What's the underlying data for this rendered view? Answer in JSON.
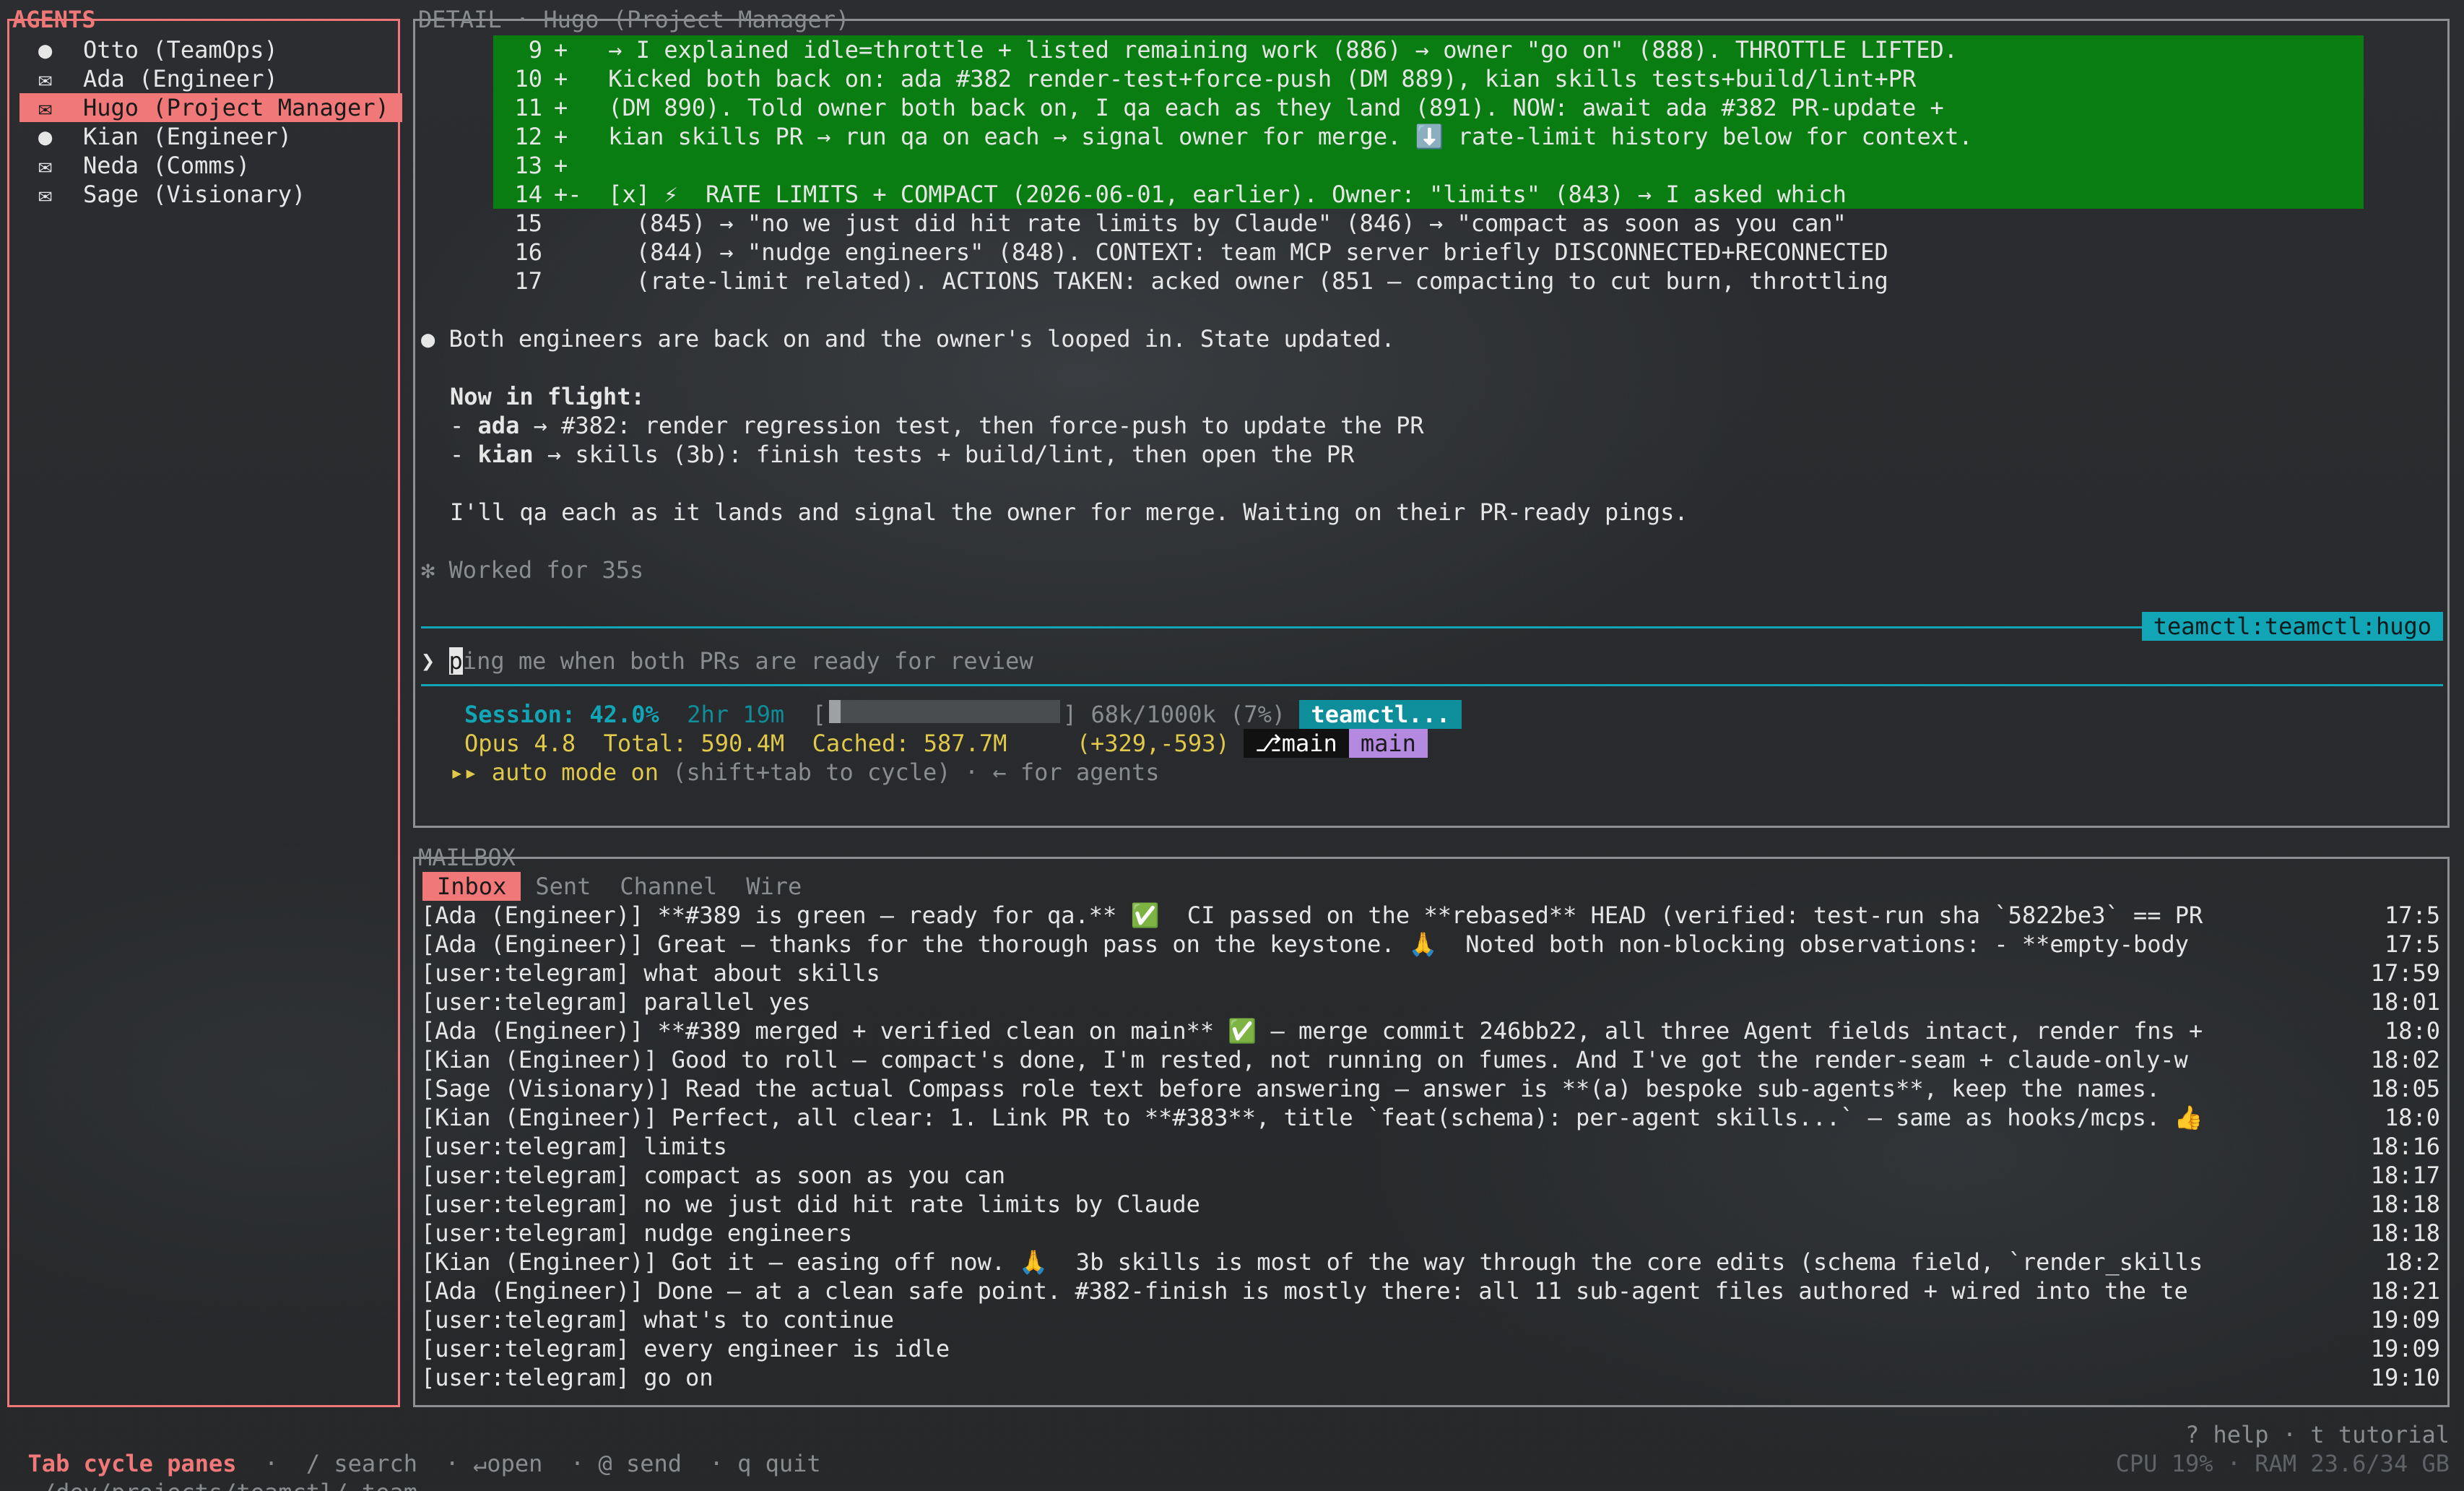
{
  "agents": {
    "title": "AGENTS",
    "items": [
      {
        "mark": "●",
        "name": "Otto (TeamOps)"
      },
      {
        "mark": "✉",
        "name": "Ada (Engineer)"
      },
      {
        "mark": "✉",
        "name": "Hugo (Project Manager)",
        "selected": true
      },
      {
        "mark": "●",
        "name": "Kian (Engineer)"
      },
      {
        "mark": "✉",
        "name": "Neda (Comms)"
      },
      {
        "mark": "✉",
        "name": "Sage (Visionary)"
      }
    ]
  },
  "detail": {
    "title": "DETAIL · Hugo (Project Manager)",
    "diff": [
      {
        "num": "9",
        "sign": "+",
        "text": " → I explained idle=throttle + listed remaining work (886) → owner \"go on\" (888). THROTTLE LIFTED.",
        "added": true
      },
      {
        "num": "10",
        "sign": "+",
        "text": " Kicked both back on: ada #382 render-test+force-push (DM 889), kian skills tests+build/lint+PR",
        "added": true
      },
      {
        "num": "11",
        "sign": "+",
        "text": " (DM 890). Told owner both back on, I qa each as they land (891). NOW: await ada #382 PR-update +",
        "added": true
      },
      {
        "num": "12",
        "sign": "+",
        "text": " kian skills PR → run qa on each → signal owner for merge. ⬇️ rate-limit history below for context.",
        "added": true
      },
      {
        "num": "13",
        "sign": "+",
        "text": "",
        "added": true
      },
      {
        "num": "14",
        "sign": "+-",
        "text": " [x] ⚡  RATE LIMITS + COMPACT (2026-06-01, earlier). Owner: \"limits\" (843) → I asked which",
        "added": true
      },
      {
        "num": "15",
        "sign": "",
        "text": "   (845) → \"no we just did hit rate limits by Claude\" (846) → \"compact as soon as you can\"",
        "added": false
      },
      {
        "num": "16",
        "sign": "",
        "text": "   (844) → \"nudge engineers\" (848). CONTEXT: team MCP server briefly DISCONNECTED+RECONNECTED",
        "added": false
      },
      {
        "num": "17",
        "sign": "",
        "text": "   (rate-limit related). ACTIONS TAKEN: acked owner (851 — compacting to cut burn, throttling",
        "added": false
      }
    ],
    "summary": "● Both engineers are back on and the owner's looped in. State updated.",
    "inflight_title": "Now in flight:",
    "inflight": [
      {
        "who": "ada",
        "text": " → #382: render regression test, then force-push to update the PR"
      },
      {
        "who": "kian",
        "text": " → skills (3b): finish tests + build/lint, then open the PR"
      }
    ],
    "closing": "I'll qa each as it lands and signal the owner for merge. Waiting on their PR-ready pings.",
    "worked": "✻ Worked for 35s",
    "session_tag": "teamctl:teamctl:hugo",
    "prompt_symbol": "❯",
    "prompt_first": "p",
    "prompt_rest": "ing me when both PRs are ready for review",
    "status": {
      "session_label": "Session:",
      "session_pct": "42.0%",
      "elapsed": "2hr 19m",
      "context_usage_fraction": 0.07,
      "tokens": "68k/1000k (7%)",
      "tag1": "teamctl...",
      "model": "Opus 4.8",
      "total": "Total: 590.4M",
      "cached": "Cached: 587.7M",
      "diffstat": "(+329,-593)",
      "branch_icon": "⎇",
      "branch1": "main",
      "branch2": "main",
      "auto_prefix": "▸▸ auto mode on",
      "auto_hint": " (shift+tab to cycle) · ← for agents"
    }
  },
  "mailbox": {
    "title": "MAILBOX",
    "tabs": [
      "Inbox",
      "Sent",
      "Channel",
      "Wire"
    ],
    "messages": [
      {
        "text": "[Ada (Engineer)] **#389 is green — ready for qa.** ✅  CI passed on the **rebased** HEAD (verified: test-run sha `5822be3` == PR",
        "time": "17:5"
      },
      {
        "text": "[Ada (Engineer)] Great — thanks for the thorough pass on the keystone. 🙏  Noted both non-blocking observations: - **empty-body",
        "time": "17:5"
      },
      {
        "text": "[user:telegram] what about skills",
        "time": "17:59"
      },
      {
        "text": "[user:telegram] parallel yes",
        "time": "18:01"
      },
      {
        "text": "[Ada (Engineer)] **#389 merged + verified clean on main** ✅ — merge commit 246bb22, all three Agent fields intact, render fns +",
        "time": "18:0"
      },
      {
        "text": "[Kian (Engineer)] Good to roll — compact's done, I'm rested, not running on fumes. And I've got the render-seam + claude-only-w",
        "time": "18:02"
      },
      {
        "text": "[Sage (Visionary)] Read the actual Compass role text before answering — answer is **(a) bespoke sub-agents**, keep the names.",
        "time": "18:05"
      },
      {
        "text": "[Kian (Engineer)] Perfect, all clear: 1. Link PR to **#383**, title `feat(schema): per-agent skills...` — same as hooks/mcps. 👍",
        "time": "18:0"
      },
      {
        "text": "[user:telegram] limits",
        "time": "18:16"
      },
      {
        "text": "[user:telegram] compact as soon as you can",
        "time": "18:17"
      },
      {
        "text": "[user:telegram] no we just did hit rate limits by Claude",
        "time": "18:18"
      },
      {
        "text": "[user:telegram] nudge engineers",
        "time": "18:18"
      },
      {
        "text": "[Kian (Engineer)] Got it — easing off now. 🙏  3b skills is most of the way through the core edits (schema field, `render_skills",
        "time": "18:2"
      },
      {
        "text": "[Ada (Engineer)] Done — at a clean safe point. #382-finish is mostly there: all 11 sub-agent files authored + wired into the te",
        "time": "18:21"
      },
      {
        "text": "[user:telegram] what's to continue",
        "time": "19:09"
      },
      {
        "text": "[user:telegram] every engineer is idle",
        "time": "19:09"
      },
      {
        "text": "[user:telegram] go on",
        "time": "19:10"
      }
    ]
  },
  "footer": {
    "tab_hint": "Tab cycle panes",
    "hints": "  ·  / search  · ↵open  · @ send  · q quit",
    "right_hints": "? help · t tutorial",
    "path": "~/dev/projects/teamctl/.team",
    "sysinfo": "CPU 19% · RAM 23.6/34 GB"
  }
}
